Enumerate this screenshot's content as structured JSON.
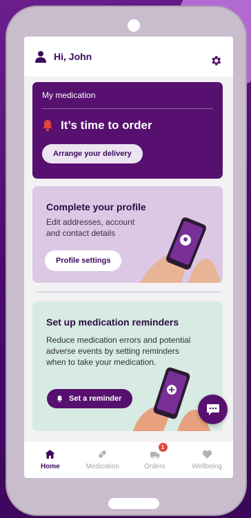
{
  "header": {
    "greeting": "Hi, John"
  },
  "medication_card": {
    "title": "My medication",
    "alert": "It’s time to order",
    "button": "Arrange your delivery"
  },
  "profile_card": {
    "title": "Complete your profile",
    "description": "Edit addresses, account and contact details",
    "button": "Profile settings"
  },
  "reminder_card": {
    "title": "Set up medication reminders",
    "description": "Reduce medication errors and potential adverse events by setting reminders when to take your medication.",
    "button": "Set a reminder"
  },
  "tabs": [
    {
      "label": "Home",
      "icon": "home-icon",
      "active": true
    },
    {
      "label": "Medication",
      "icon": "pill-icon",
      "active": false
    },
    {
      "label": "Orders",
      "icon": "truck-icon",
      "active": false,
      "badge": "1"
    },
    {
      "label": "Wellbeing",
      "icon": "heart-icon",
      "active": false
    }
  ],
  "colors": {
    "primary": "#57106f",
    "profile_bg": "#dcc8e4",
    "reminder_bg": "#d7eae3",
    "alert": "#e0463a"
  }
}
